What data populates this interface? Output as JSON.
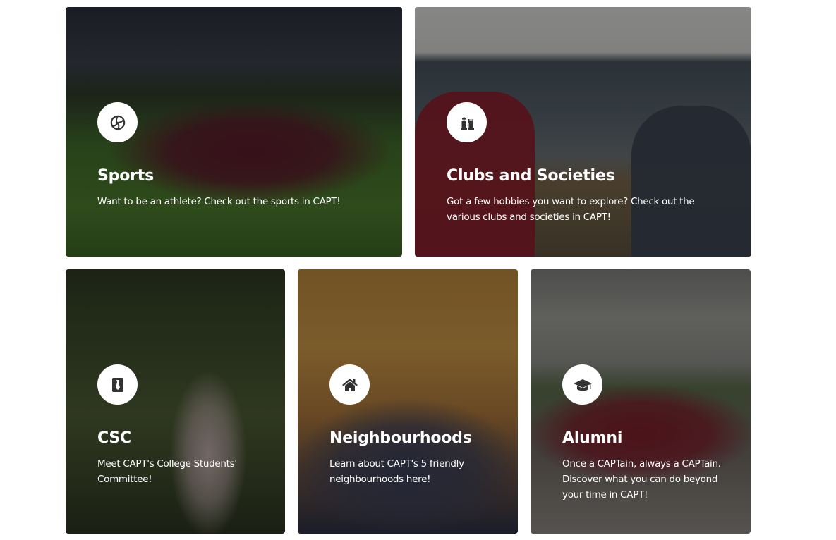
{
  "cards": [
    {
      "id": "sports",
      "title": "Sports",
      "description": "Want to be an athlete? Check out the sports in CAPT!",
      "icon": "volleyball-icon"
    },
    {
      "id": "clubs",
      "title": "Clubs and Societies",
      "description": "Got a few hobbies you want to explore? Check out the various clubs and societies in CAPT!",
      "icon": "chess-icon"
    },
    {
      "id": "csc",
      "title": "CSC",
      "description": "Meet CAPT's College Students' Committee!",
      "icon": "tie-icon"
    },
    {
      "id": "neighbourhoods",
      "title": "Neighbourhoods",
      "description": "Learn about CAPT's 5 friendly neighbourhoods here!",
      "icon": "home-icon"
    },
    {
      "id": "alumni",
      "title": "Alumni",
      "description": "Once a CAPTain, always a CAPTain. Discover what you can do beyond your time in CAPT!",
      "icon": "graduation-cap-icon"
    }
  ],
  "colors": {
    "icon_circle": "#ffffff",
    "icon_glyph": "#333333",
    "text": "#ffffff"
  }
}
